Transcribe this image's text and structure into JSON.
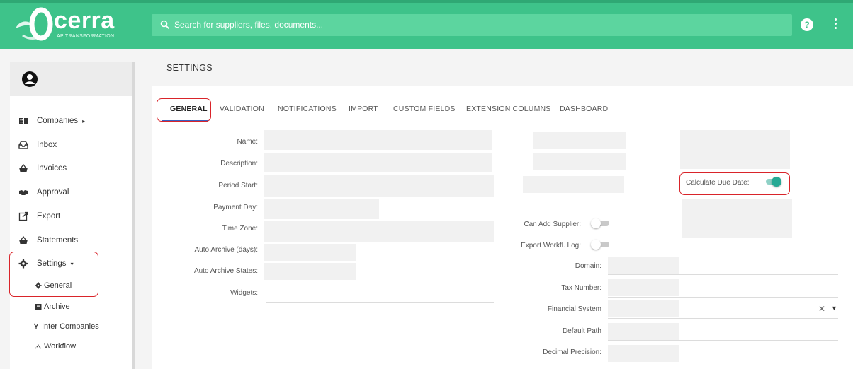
{
  "app": {
    "logo_text": "cerra",
    "logo_tagline": "AP TRANSFORMATION",
    "search_placeholder": "Search for suppliers, files, documents...",
    "help_label": "?"
  },
  "sidebar": {
    "items": [
      {
        "label": "Companies",
        "icon": "building-icon",
        "suffix": "▸"
      },
      {
        "label": "Inbox",
        "icon": "inbox-icon"
      },
      {
        "label": "Invoices",
        "icon": "basket-icon"
      },
      {
        "label": "Approval",
        "icon": "handshake-icon"
      },
      {
        "label": "Export",
        "icon": "export-icon"
      },
      {
        "label": "Statements",
        "icon": "basket-icon"
      },
      {
        "label": "Settings",
        "icon": "gear-icon",
        "suffix": "▾"
      }
    ],
    "sub_items": [
      {
        "label": "General",
        "icon": "gear-icon"
      },
      {
        "label": "Archive",
        "icon": "archive-icon"
      },
      {
        "label": "Inter Companies",
        "icon": "branch-icon"
      },
      {
        "label": "Workflow",
        "icon": "workflow-icon"
      }
    ]
  },
  "page": {
    "title": "SETTINGS",
    "tabs": [
      "GENERAL",
      "VALIDATION",
      "NOTIFICATIONS",
      "IMPORT",
      "CUSTOM FIELDS",
      "EXTENSION COLUMNS",
      "DASHBOARD"
    ],
    "active_tab": "GENERAL"
  },
  "form": {
    "left_labels": [
      "Name:",
      "Description:",
      "Period Start:",
      "Payment Day:",
      "Time Zone:",
      "Auto Archive (days):",
      "Auto Archive States:",
      "Widgets:"
    ],
    "calculate_due_date": {
      "label": "Calculate Due Date:",
      "on": true
    },
    "can_add_supplier": {
      "label": "Can Add Supplier:",
      "on": false
    },
    "export_workfl_log": {
      "label": "Export Workfl. Log:",
      "on": false
    },
    "right_labels": [
      "Domain:",
      "Tax Number:",
      "Financial System",
      "Default Path",
      "Decimal Precision:"
    ],
    "financial_system_clear": "✕",
    "financial_system_arrow": "▼"
  },
  "colors": {
    "brand": "#3ec38a",
    "highlight": "#d9242a",
    "toggle_on": "#26a994",
    "tab_underline": "#3a5fc0"
  }
}
